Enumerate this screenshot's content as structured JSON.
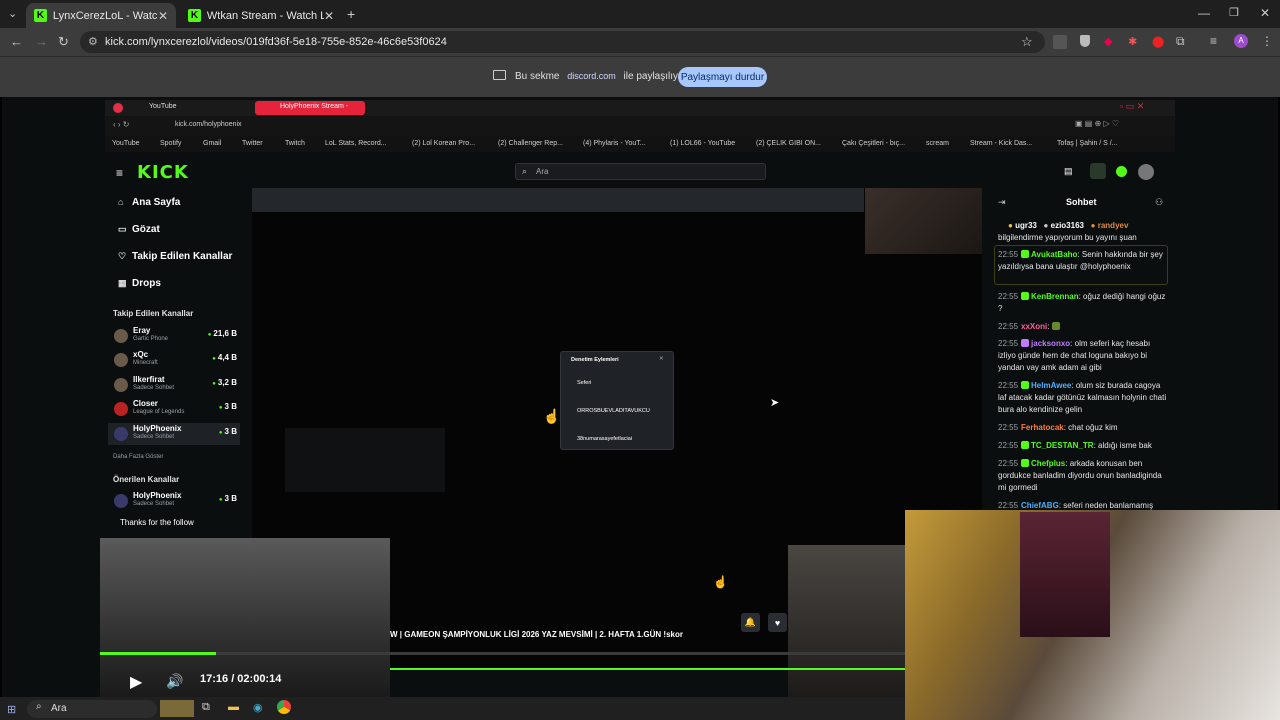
{
  "browser": {
    "tabs": [
      {
        "label": "LynxCerezLoL - Watch the V",
        "active": true
      },
      {
        "label": "Wtkan Stream - Watch Live on",
        "active": false
      }
    ],
    "url": "kick.com/lynxcerezlol/videos/019fd36f-5e18-755e-852e-46c6e53f0624",
    "share_bar": {
      "prefix": "Bu sekme",
      "domain": "discord.com",
      "suffix": "ile paylaşılıyor",
      "stop_button": "Paylaşmayı durdur"
    }
  },
  "shared_screen": {
    "inner_tabs": [
      "YouTube",
      "HolyPhoenix Stream - "
    ],
    "inner_url": "kick.com/holyphoenix",
    "bookmarks": [
      "YouTube",
      "Spotify",
      "Gmail",
      "Twitter",
      "Twitch",
      "LoL Stats, Record...",
      "(2) Lol Korean Pro...",
      "(2) Challenger Rep...",
      "(4) Phylaris - YouT...",
      "(1) LOL66 - YouTube",
      "(2) ÇELIK GIBI ON...",
      "Çakı Çeşitleri - bıç...",
      "scream",
      "Stream - Kick Das...",
      "Tofaş | Şahin / S /..."
    ],
    "search_placeholder": "Ara",
    "nav": [
      {
        "label": "Ana Sayfa",
        "icon": "home-icon"
      },
      {
        "label": "Gözat",
        "icon": "browse-icon"
      },
      {
        "label": "Takip Edilen Kanallar",
        "icon": "heart-icon"
      },
      {
        "label": "Drops",
        "icon": "drops-icon"
      }
    ],
    "followed_heading": "Takip Edilen Kanallar",
    "channels": [
      {
        "name": "Eray",
        "game": "Gartic Phone",
        "viewers": "21,6 B"
      },
      {
        "name": "xQc",
        "game": "Minecraft",
        "viewers": "4,4 B"
      },
      {
        "name": "Ilkerfirat",
        "game": "Sadece Sohbet",
        "viewers": "3,2 B"
      },
      {
        "name": "Closer",
        "game": "League of Legends",
        "viewers": "3 B"
      },
      {
        "name": "HolyPhoenix",
        "game": "Sadece Sohbet",
        "viewers": "3 B"
      }
    ],
    "show_more": "Daha Fazla Göster",
    "recommended_heading": "Önerilen Kanallar",
    "recommended": [
      {
        "name": "HolyPhoenix",
        "game": "Sadece Sohbet",
        "viewers": "3 B"
      }
    ],
    "popup": {
      "title": "Denetim Eylemleri",
      "items": [
        "Seferi",
        "ORROSBUEVLADITAVUKCU",
        "38numarasayefetlaciai"
      ]
    },
    "chat": {
      "title": "Sohbet",
      "top_gifters": [
        "ugr33",
        "ezio3163",
        "randyev"
      ],
      "first_line": "bilgilendirme yapıyorum bu yayını şuan",
      "messages": [
        {
          "time": "22:55",
          "user": "AvukatBaho",
          "color": "#53fc18",
          "text": "Senin hakkında bir şey yazıldıysa bana ulaştır @holyphoenix"
        },
        {
          "time": "22:55",
          "user": "KenBrennan",
          "color": "#53fc18",
          "text": "oğuz dediği hangi oğuz ?"
        },
        {
          "time": "22:55",
          "user": "xxXoni",
          "color": "#ff5e9a",
          "text": ""
        },
        {
          "time": "22:55",
          "user": "jacksonxo",
          "color": "#c07bff",
          "text": "olm seferi kaç hesabı izliyo günde hem de chat loguna bakıyo bi yandan vay amk adam ai gibi"
        },
        {
          "time": "22:55",
          "user": "HelmAwee",
          "color": "#4fb0ff",
          "text": "olum siz burada cagoya laf atacak kadar götünüz kalmasın holynin chati bura alo kendinize gelin"
        },
        {
          "time": "22:55",
          "user": "Ferhatocak",
          "color": "#ff7d3d",
          "text": "chat oğuz kim"
        },
        {
          "time": "22:55",
          "user": "TC_DESTAN_TR",
          "color": "#53fc18",
          "text": "aldığı isme bak"
        },
        {
          "time": "22:55",
          "user": "Chefplus",
          "color": "#53fc18",
          "text": "arkada konusan ben gordukce banladim diyordu onun banladiginda mi gormedi"
        },
        {
          "time": "22:55",
          "user": "ChiefABG",
          "color": "#4fb0ff",
          "text": "seferi neden banlamamış"
        }
      ]
    },
    "video_title": "W | GAMEON ŞAMPİYONLUK LİGİ 2026 YAZ MEVSİMİ | 2. HAFTA 1.GÜN !skor",
    "follow_overlay": "Thanks for the follow"
  },
  "player": {
    "time": "17:16 / 02:00:14",
    "progress": 0.144
  },
  "taskbar": {
    "search": "Ara"
  }
}
